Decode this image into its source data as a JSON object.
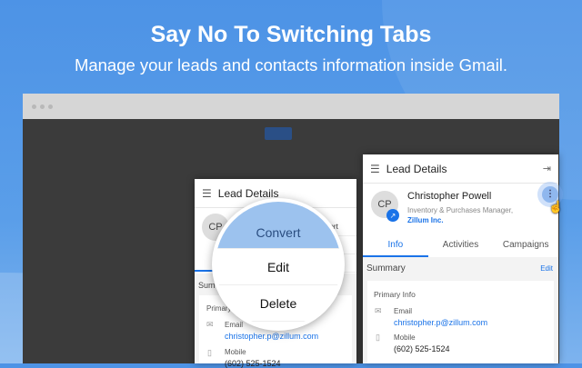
{
  "headline": "Say No To Switching Tabs",
  "subheadline": "Manage your leads and contacts information inside Gmail.",
  "panel": {
    "title": "Lead Details",
    "initials": "CP",
    "name": "Christopher Powell",
    "job": "Inventory & Purchases Manager,",
    "company": "Zillum Inc.",
    "tabs": [
      "Info",
      "Activities",
      "Campaigns"
    ],
    "summary": "Summary",
    "edit": "Edit",
    "primary_info": "Primary Info",
    "email_label": "Email",
    "email": "christopher.p@zillum.com",
    "mobile_label": "Mobile",
    "mobile": "(602) 525-1524",
    "summary_short": "Sum",
    "primary_short": "Primary"
  },
  "menu": {
    "items": [
      "Convert",
      "Edit",
      "Delete"
    ],
    "mini": [
      "nvert",
      "t",
      "e"
    ]
  }
}
